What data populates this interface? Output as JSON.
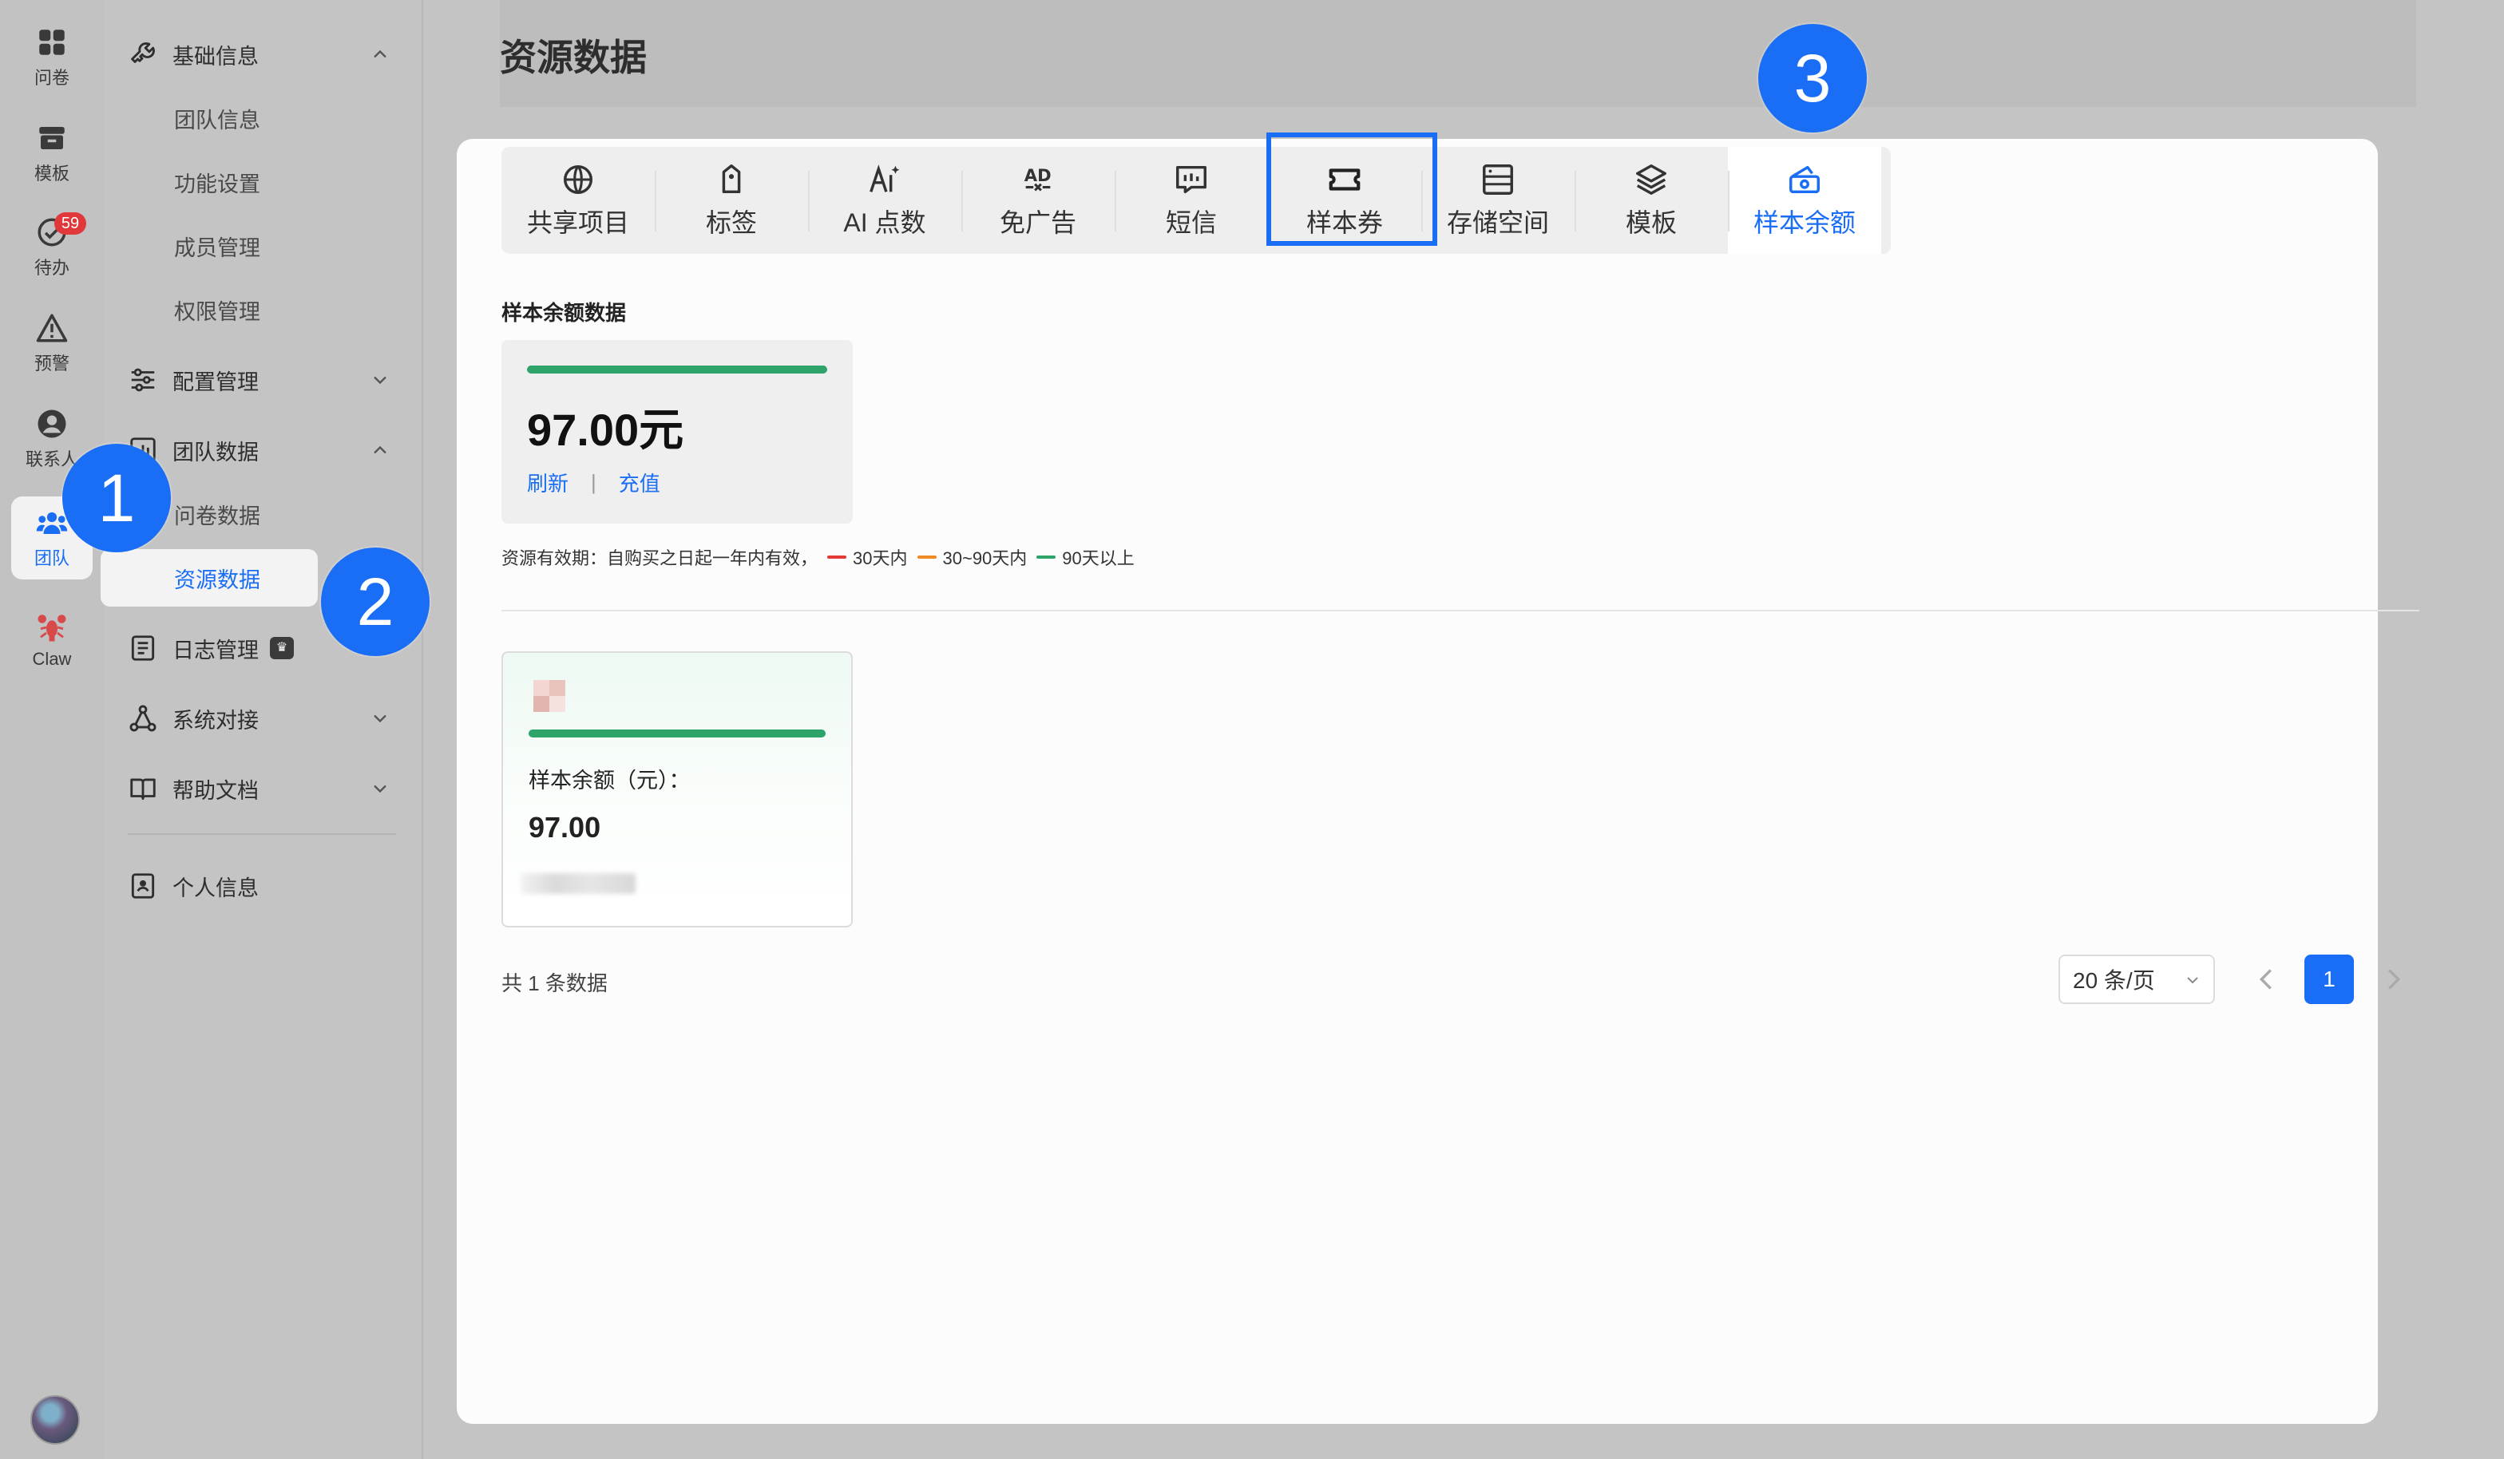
{
  "rail": {
    "items": [
      {
        "label": "问卷",
        "icon": "grid-icon"
      },
      {
        "label": "模板",
        "icon": "archive-icon"
      },
      {
        "label": "待办",
        "icon": "check-circle-icon",
        "badge": "59"
      },
      {
        "label": "预警",
        "icon": "warning-icon"
      },
      {
        "label": "联系人",
        "icon": "contact-icon"
      },
      {
        "label": "团队",
        "icon": "team-icon",
        "active": true
      },
      {
        "label": "Claw",
        "icon": "lobster-icon"
      }
    ]
  },
  "sidebar": {
    "groups": [
      {
        "label": "基础信息",
        "icon": "wrench-icon",
        "expanded": true,
        "children": [
          "团队信息",
          "功能设置",
          "成员管理",
          "权限管理"
        ]
      },
      {
        "label": "配置管理",
        "icon": "sliders-icon",
        "expanded": false
      },
      {
        "label": "团队数据",
        "icon": "chart-icon",
        "expanded": true,
        "children": [
          "问卷数据",
          "资源数据"
        ]
      },
      {
        "label": "日志管理",
        "icon": "log-icon",
        "badge": "vip"
      },
      {
        "label": "系统对接",
        "icon": "network-icon",
        "expanded": false
      },
      {
        "label": "帮助文档",
        "icon": "book-icon",
        "expanded": false
      },
      {
        "label": "个人信息",
        "icon": "person-card-icon"
      }
    ],
    "active_item": "资源数据"
  },
  "page": {
    "title": "资源数据"
  },
  "tabs": [
    {
      "label": "共享项目",
      "icon": "globe-icon"
    },
    {
      "label": "标签",
      "icon": "tag-icon"
    },
    {
      "label": "AI 点数",
      "icon": "ai-icon"
    },
    {
      "label": "免广告",
      "icon": "no-ad-icon"
    },
    {
      "label": "短信",
      "icon": "sms-icon"
    },
    {
      "label": "样本券",
      "icon": "ticket-icon"
    },
    {
      "label": "存储空间",
      "icon": "storage-icon"
    },
    {
      "label": "模板",
      "icon": "layers-icon"
    },
    {
      "label": "样本余额",
      "icon": "wallet-icon",
      "active": true
    }
  ],
  "summary": {
    "section_title": "样本余额数据",
    "amount": "97.00元",
    "refresh": "刷新",
    "separator": "|",
    "recharge": "充值"
  },
  "validity": {
    "text": "资源有效期：自购买之日起一年内有效，",
    "legend": [
      {
        "label": "30天内",
        "color": "#e53935"
      },
      {
        "label": "30~90天内",
        "color": "#f08a24"
      },
      {
        "label": "90天以上",
        "color": "#2ea36a"
      }
    ]
  },
  "item": {
    "label": "样本余额（元）：",
    "value": "97.00"
  },
  "pagination": {
    "total": "共 1 条数据",
    "page_size": "20 条/页",
    "current_page": "1"
  },
  "steps": [
    "1",
    "2",
    "3"
  ],
  "colors": {
    "accent": "#1a6ef5",
    "green": "#2ea36a",
    "badge": "#e0383b"
  }
}
